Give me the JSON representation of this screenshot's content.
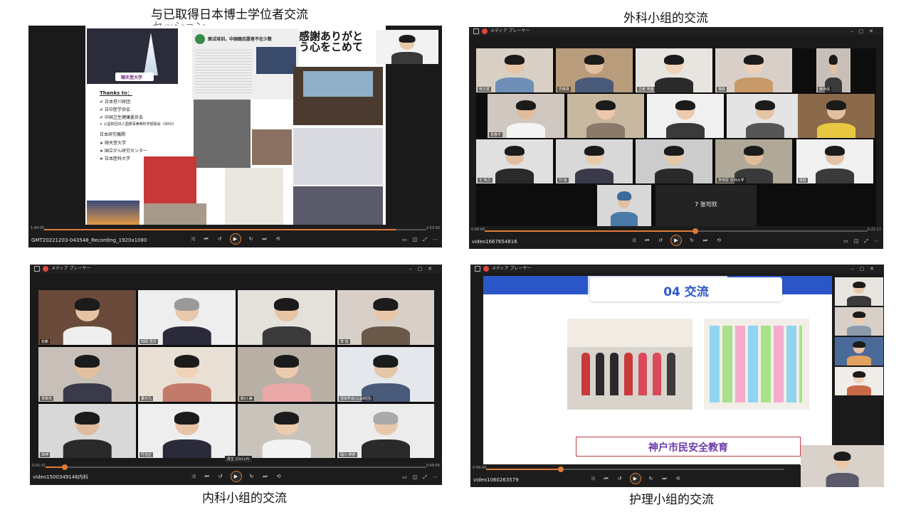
{
  "captions": {
    "top_left": "与已取得日本博士学位者交流",
    "top_left_overlay": "セッション",
    "top_right": "外科小组的交流",
    "bottom_left": "内科小组的交流",
    "bottom_right": "护理小组的交流"
  },
  "player_title": "メディア プレーヤー",
  "players": {
    "tl": {
      "current": "1:44:05",
      "total": "1:53:50",
      "progress": 0.92,
      "filename": "GMT20221203-043548_Recording_1920x1080"
    },
    "tr": {
      "current": "0:00:00",
      "total": "0:21:17",
      "progress": 0.55,
      "filename": "video1667654816"
    },
    "bl": {
      "current": "0:01:31",
      "total": "0:49:56",
      "progress": 0.05,
      "filename": "video1500349146内科",
      "tooltip": "再生 (Ctrl+P)"
    },
    "br": {
      "current": "0:09:49",
      "total": "",
      "progress": 0.25,
      "filename": "video1060263579"
    }
  },
  "slide_tl": {
    "thanks_title": "Thanks to：",
    "thanks_items": [
      "日本笹川财团",
      "日中医学协会",
      "中国卫生健康委员会",
      "公益財団法人国際耳鼻喉科学振興会（SPIO）"
    ],
    "institutions_title": "日本研究機関",
    "institutions": [
      "顺天堂大学",
      "国立がん研究センター",
      "日本医科大学"
    ],
    "university_badge": "顺天堂大学",
    "article_headline": "面试培训，中国踏志愿者不在少数",
    "calligraphy": "感謝ありがとう心をこめて"
  },
  "zoom_tr": {
    "names": [
      "杨文斌",
      "周琳霖",
      "吕茗 苑晨",
      "魏晨",
      "薛伟强",
      "张春平",
      "",
      "",
      "",
      "",
      "王 伟力",
      "刘 旭",
      "",
      "李伟恩 吉林大学",
      "梁跃",
      "",
      "7 张可欣"
    ]
  },
  "zoom_bl": {
    "names": [
      "张鹏",
      "田岡 浩日",
      "",
      "李 佳",
      "李晨亮",
      "董亦凡",
      "新川 美",
      "曾田学会(公益财団)",
      "田坤",
      "竹浩正",
      "",
      "堀川 伸彦"
    ]
  },
  "slide_br": {
    "heading": "04 交流",
    "banner": "神户市民安全教育"
  }
}
